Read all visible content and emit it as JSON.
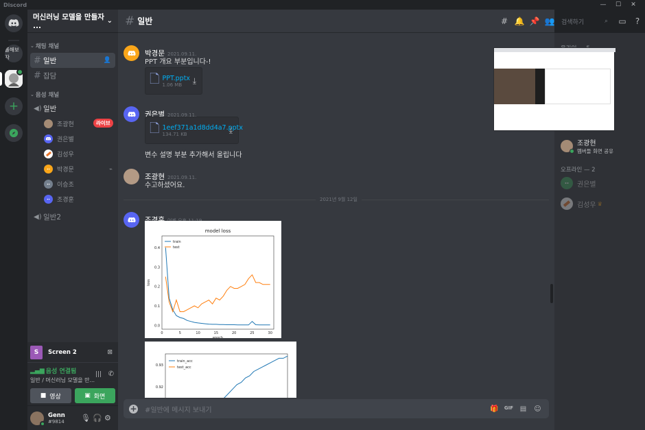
{
  "window": {
    "app_name": "Discord",
    "controls": [
      "—",
      "☐",
      "✕"
    ]
  },
  "guilds": [
    {
      "label": "",
      "icon": "discord-home-icon"
    },
    {
      "label": "롤해보자",
      "icon": ""
    },
    {
      "label": "",
      "icon": "server-avatar-icon"
    },
    {
      "label": "+",
      "icon": "add-server-icon"
    },
    {
      "label": "",
      "icon": "compass-icon"
    }
  ],
  "server": {
    "name": "머신러닝 모델을 만들자 ..."
  },
  "categories": {
    "text": "채팅 채널",
    "voice": "음성 채널"
  },
  "text_channels": [
    {
      "name": "일반",
      "active": true
    },
    {
      "name": "잡담",
      "active": false
    }
  ],
  "voice_channels": [
    {
      "name": "일반"
    },
    {
      "name": "일반2"
    }
  ],
  "voice_users": [
    {
      "name": "조광현",
      "avatar": "photo",
      "live": true
    },
    {
      "name": "권은별",
      "avatar": "blurple",
      "live": false
    },
    {
      "name": "김성우",
      "avatar": "orange-photo",
      "live": false
    },
    {
      "name": "박경문",
      "avatar": "yellow",
      "live": false
    },
    {
      "name": "이승조",
      "avatar": "gray",
      "live": false
    },
    {
      "name": "조경훈",
      "avatar": "blurple",
      "live": false
    }
  ],
  "live_badge": "라이브",
  "screen_panel": {
    "title": "Screen 2",
    "icon_letter": "S"
  },
  "voice_panel": {
    "status": "음성 연결됨",
    "location": "일반 / 머신러닝 모델을 만...",
    "video_label": "영상",
    "screen_label": "화면"
  },
  "user": {
    "name": "Genn",
    "tag": "#9814"
  },
  "chat": {
    "channel_name": "일반",
    "search_placeholder": "검색하기",
    "composer_placeholder": "#일반에 메시지 보내기",
    "date_divider": "2021년 9월 12일"
  },
  "messages": [
    {
      "author": "박경문",
      "timestamp": "2021.09.11.",
      "text": "PPT 개요 부분입니다-!",
      "avatar": "yellow",
      "file": {
        "name": "PPT.pptx",
        "size": "1.06 MB"
      }
    },
    {
      "author": "권은별",
      "timestamp": "2021.09.11.",
      "text": "변수 설명 부분 추가해서 올립니다",
      "avatar": "blurple",
      "file": {
        "name": "1eef371a1d8dd4a7.pptx",
        "size": "134.71 KB"
      }
    },
    {
      "author": "조광현",
      "timestamp": "2021.09.11.",
      "text": "수고하셨어요.",
      "avatar": "photo"
    },
    {
      "author": "조경훈",
      "timestamp": "어제 오후 11:19",
      "text": "",
      "avatar": "blurple"
    }
  ],
  "member_list": {
    "online_header": "온라인 — 5",
    "offline_header": "오프라인 — 2",
    "online_visible": [
      {
        "name": "조광현",
        "activity": "멤버들 화면 공유"
      }
    ],
    "offline": [
      {
        "name": "권은별"
      },
      {
        "name": "김성우"
      }
    ]
  },
  "chart_data": [
    {
      "type": "line",
      "title": "model loss",
      "xlabel": "epoch",
      "ylabel": "loss",
      "xlim": [
        0,
        31
      ],
      "ylim": [
        -0.02,
        0.46
      ],
      "yticks": [
        0.0,
        0.1,
        0.2,
        0.3,
        0.4
      ],
      "xticks": [
        0,
        5,
        10,
        15,
        20,
        25,
        30
      ],
      "legend": "top-left",
      "series": [
        {
          "name": "train",
          "color": "#1f77b4",
          "x": [
            1,
            2,
            3,
            4,
            5,
            6,
            7,
            8,
            9,
            10,
            11,
            12,
            13,
            14,
            15,
            16,
            17,
            18,
            19,
            20,
            21,
            22,
            23,
            24,
            25,
            26,
            27,
            28,
            29,
            30
          ],
          "values": [
            0.4,
            0.14,
            0.08,
            0.05,
            0.04,
            0.035,
            0.025,
            0.02,
            0.015,
            0.012,
            0.01,
            0.008,
            0.006,
            0.005,
            0.005,
            0.004,
            0.004,
            0.003,
            0.003,
            0.003,
            0.002,
            0.002,
            0.002,
            0.002,
            0.02,
            0.003,
            0.002,
            0.002,
            0.002,
            0.002
          ]
        },
        {
          "name": "test",
          "color": "#ff7f0e",
          "x": [
            1,
            2,
            3,
            4,
            5,
            6,
            7,
            8,
            9,
            10,
            11,
            12,
            13,
            14,
            15,
            16,
            17,
            18,
            19,
            20,
            21,
            22,
            23,
            24,
            25,
            26,
            27,
            28,
            29,
            30
          ],
          "values": [
            0.25,
            0.12,
            0.07,
            0.13,
            0.07,
            0.07,
            0.08,
            0.09,
            0.1,
            0.09,
            0.11,
            0.12,
            0.13,
            0.11,
            0.14,
            0.13,
            0.15,
            0.18,
            0.2,
            0.19,
            0.19,
            0.2,
            0.21,
            0.24,
            0.26,
            0.22,
            0.22,
            0.21,
            0.21,
            0.21
          ]
        }
      ]
    },
    {
      "type": "line",
      "title": "",
      "ylabel": "",
      "yticks": [
        0.92,
        0.93
      ],
      "ylim": [
        0.91,
        0.935
      ],
      "legend": "top-left",
      "series": [
        {
          "name": "train_acc",
          "color": "#1f77b4",
          "x": [
            14,
            15,
            16,
            17,
            18,
            19,
            20,
            21,
            22,
            23,
            24,
            25,
            26,
            27,
            28,
            29,
            30
          ],
          "values": [
            0.913,
            0.915,
            0.917,
            0.919,
            0.921,
            0.922,
            0.924,
            0.925,
            0.927,
            0.928,
            0.929,
            0.93,
            0.931,
            0.932,
            0.933,
            0.933,
            0.934
          ]
        },
        {
          "name": "test_acc",
          "color": "#ff7f0e",
          "x": [],
          "values": []
        }
      ]
    }
  ]
}
